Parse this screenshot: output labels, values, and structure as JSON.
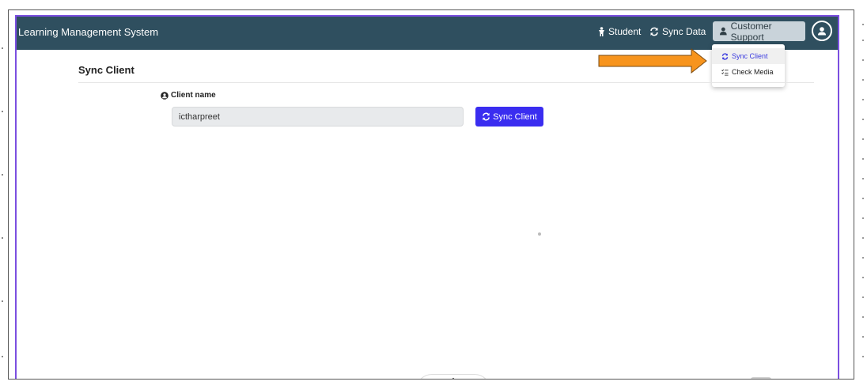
{
  "navbar": {
    "brand": "Learning Management System",
    "links": [
      {
        "label": "Student",
        "icon": "person-icon"
      },
      {
        "label": "Sync Data",
        "icon": "sync-icon"
      }
    ],
    "support_label": "Customer Support",
    "support_icon": "support-person-icon",
    "account_icon": "user-circle-icon"
  },
  "dropdown": {
    "items": [
      {
        "label": "Sync Client",
        "icon": "sync-icon",
        "active": true
      },
      {
        "label": "Check Media",
        "icon": "checklist-icon",
        "active": false
      }
    ]
  },
  "page": {
    "title": "Sync Client",
    "field_label": "Client name",
    "field_icon": "user-circle-icon",
    "client_value": "ictharpreet",
    "sync_button_label": "Sync Client",
    "sync_button_icon": "sync-icon"
  },
  "annotation": {
    "arrow_color": "#f7941d",
    "arrow_icon": "arrow-right-icon"
  },
  "colors": {
    "navbar": "#2f4f5f",
    "highlight_frame": "#7b4fe0",
    "primary_button": "#3a2df0"
  }
}
